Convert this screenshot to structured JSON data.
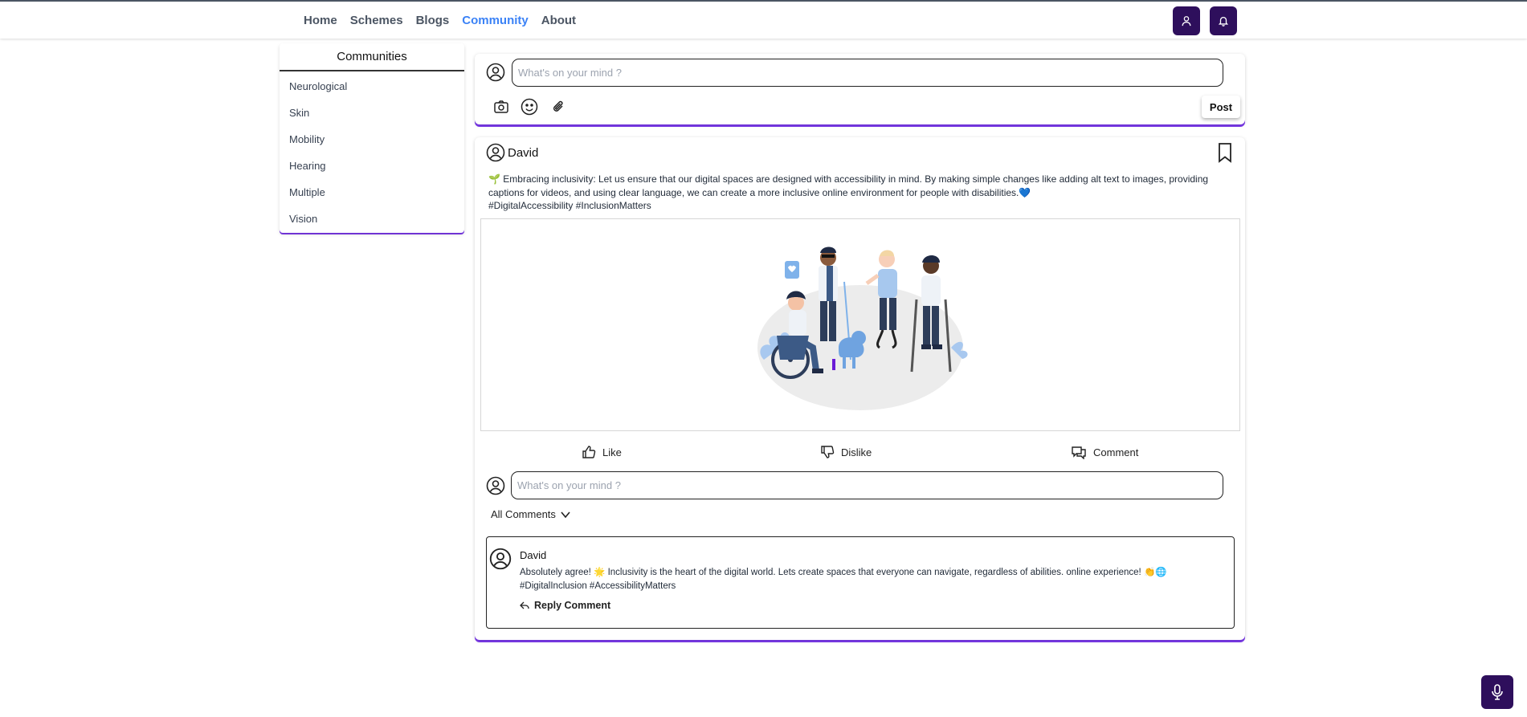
{
  "nav": {
    "items": [
      "Home",
      "Schemes",
      "Blogs",
      "Community",
      "About"
    ],
    "active": "Community",
    "profile_icon": "user-icon",
    "notification_icon": "bell-icon"
  },
  "sidebar": {
    "title": "Communities",
    "items": [
      "Neurological",
      "Skin",
      "Mobility",
      "Hearing",
      "Multiple",
      "Vision"
    ]
  },
  "composer": {
    "placeholder": "What's on your mind ?",
    "icons": [
      "camera-icon",
      "smiley-icon",
      "paperclip-icon"
    ],
    "post_label": "Post"
  },
  "post": {
    "author": "David",
    "text_line1": "Embracing inclusivity: Let us ensure that our digital spaces are designed with accessibility in mind. By making simple changes like adding alt text to images, providing captions for videos, and using clear language, we can create a more inclusive online environment for people with disabilities.",
    "hashtags": "#DigitalAccessibility #InclusionMatters",
    "actions": {
      "like": "Like",
      "dislike": "Dislike",
      "comment": "Comment"
    },
    "comment_placeholder": "What's on your mind ?",
    "all_comments_label": "All Comments"
  },
  "comments": [
    {
      "author": "David",
      "text": "Absolutely agree! 🌟 Inclusivity is the heart of the digital world. Lets create spaces that everyone can navigate, regardless of abilities. online experience! 👏🌐",
      "hashtags": "#DigitalInclusion #AccessibilityMatters",
      "reply_label": "Reply Comment"
    }
  ],
  "colors": {
    "accent": "#2e0f5c",
    "active_link": "#3b82f6",
    "card_border": "#7c3aed"
  }
}
